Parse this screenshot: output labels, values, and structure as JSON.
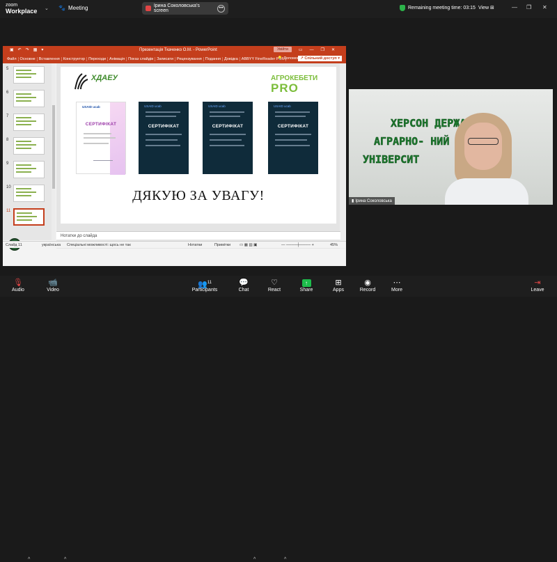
{
  "app": {
    "logo_line1": "zoom",
    "logo_line2": "Workplace",
    "meeting_label": "Meeting",
    "screen_share_label": "Ірина Соколовська's screen",
    "remaining_time": "Remaining meeting time: 03:15",
    "view_label": "View"
  },
  "ppt": {
    "window_title": "Презентація Ткаченко О.М. - PowerPoint",
    "login_label": "Увійти",
    "tabs": [
      "Файл",
      "Основне",
      "Вставлення",
      "Конструктор",
      "Переходи",
      "Анімація",
      "Показ слайдів",
      "Записати",
      "Рецензування",
      "Подання",
      "Довідка",
      "ABBYY FineReader PDF"
    ],
    "help_label": "Допомог",
    "share_label": "Спільний доступ",
    "thumb_numbers": [
      "5",
      "6",
      "7",
      "8",
      "9",
      "10",
      "11"
    ],
    "notes_placeholder": "Нотатки до слайда",
    "status": {
      "slide": "Слайд 11",
      "language": "українська",
      "accessibility": "Спеціальні можливості: щось не так",
      "notes": "Нотатки",
      "comments": "Примітки",
      "zoom": "45%"
    }
  },
  "slide": {
    "university_abbr": "ХДАЕУ",
    "agro_top": "АГРОКЕБЕТИ",
    "agro_bottom": "PRO",
    "certificates": [
      {
        "title": "СЕРТИФІКАТ",
        "logos": "USAID  ucab",
        "name": "Ткаченко Олексій"
      },
      {
        "title": "СЕРТИФІКАТ",
        "logos": "USAID  ucab",
        "name": "Ткаченко Олексій"
      },
      {
        "title": "СЕРТИФІКАТ",
        "logos": "USAID  ucab",
        "name": "Ткаченко Олексій"
      },
      {
        "title": "СЕРТИФІКАТ",
        "logos": "USAID  ucab",
        "name": "Ткаченко Олексій"
      }
    ],
    "thanks": "ДЯКУЮ ЗА УВАГУ!"
  },
  "video": {
    "wall_line1": "ХЕРСОН      ДЕРЖАВНИЙ",
    "wall_line2": "АГРАРНО-       НИЙ",
    "wall_line3": "УНІВЕРСИТ",
    "participant_name": "Ірина Соколовська"
  },
  "toolbar": {
    "audio": "Audio",
    "video": "Video",
    "participants": "Participants",
    "participants_count": "11",
    "chat": "Chat",
    "react": "React",
    "share": "Share",
    "apps": "Apps",
    "record": "Record",
    "more": "More",
    "leave": "Leave"
  },
  "colors": {
    "ppt_accent": "#c43e1c",
    "zoom_share_green": "#1dbd4b",
    "leave_red": "#e04545"
  }
}
